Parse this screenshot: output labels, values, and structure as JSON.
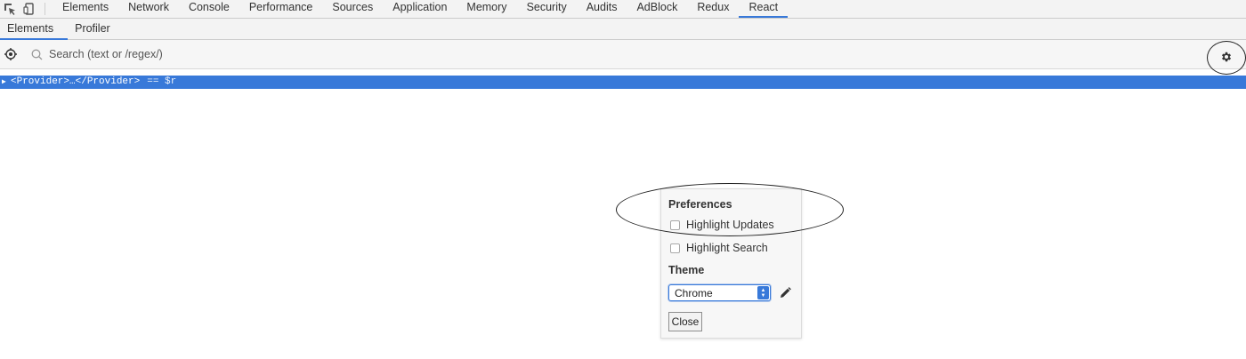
{
  "devtools": {
    "tabs": [
      {
        "label": "Elements"
      },
      {
        "label": "Network"
      },
      {
        "label": "Console"
      },
      {
        "label": "Performance"
      },
      {
        "label": "Sources"
      },
      {
        "label": "Application"
      },
      {
        "label": "Memory"
      },
      {
        "label": "Security"
      },
      {
        "label": "Audits"
      },
      {
        "label": "AdBlock"
      },
      {
        "label": "Redux"
      },
      {
        "label": "React"
      }
    ],
    "active_tab": "React"
  },
  "react_panel": {
    "sub_tabs": [
      {
        "label": "Elements"
      },
      {
        "label": "Profiler"
      }
    ],
    "active_sub_tab": "Elements",
    "search": {
      "placeholder": "Search (text or /regex/)",
      "value": ""
    },
    "tree": {
      "selected_row": {
        "node_text": "<Provider>…</Provider>",
        "ref_text": "== $r"
      }
    }
  },
  "preferences": {
    "title": "Preferences",
    "highlight_updates": {
      "label": "Highlight Updates",
      "checked": false
    },
    "highlight_search": {
      "label": "Highlight Search",
      "checked": false
    },
    "theme_title": "Theme",
    "theme_select": {
      "value": "Chrome"
    },
    "close_label": "Close"
  },
  "colors": {
    "accent": "#3879d9",
    "toolbar_bg": "#f3f3f3",
    "selection_text": "#ffffff"
  },
  "icons": [
    "inspect-element-icon",
    "device-toggle-icon",
    "target-icon",
    "search-icon",
    "gear-icon",
    "pencil-icon",
    "disclosure-triangle-icon",
    "select-arrows-icon"
  ]
}
